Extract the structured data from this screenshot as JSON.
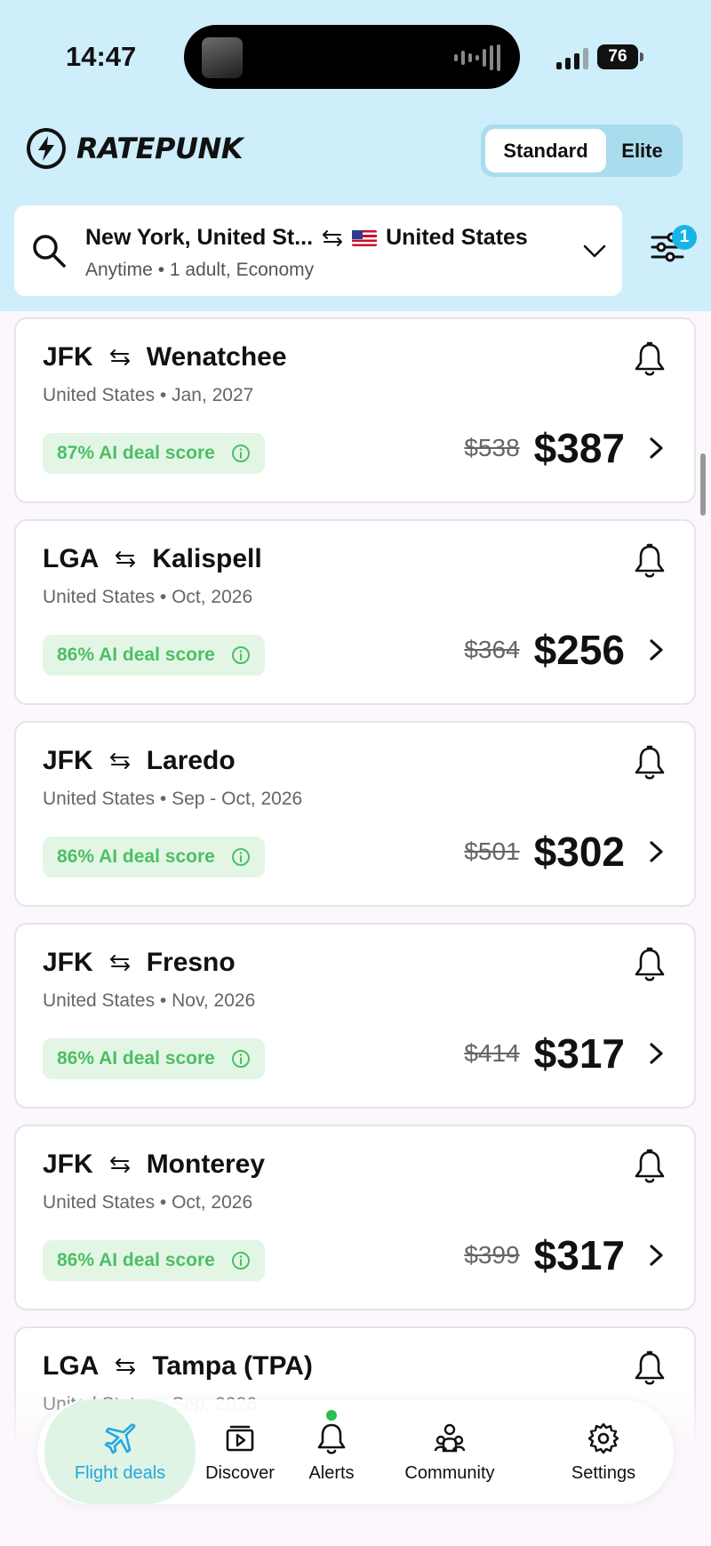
{
  "status_bar": {
    "time": "14:47",
    "battery": "76"
  },
  "brand": {
    "name": "RATEPUNK"
  },
  "plan_toggle": {
    "standard": "Standard",
    "elite": "Elite"
  },
  "search": {
    "origin": "New York, United St...",
    "destination": "United States",
    "details": "Anytime • 1 adult, Economy"
  },
  "filters": {
    "badge": "1"
  },
  "deals": [
    {
      "from": "JFK",
      "to": "Wenatchee",
      "meta": "United States • Jan, 2027",
      "score": "87% AI deal score",
      "old_price": "$538",
      "price": "$387"
    },
    {
      "from": "LGA",
      "to": "Kalispell",
      "meta": "United States • Oct, 2026",
      "score": "86% AI deal score",
      "old_price": "$364",
      "price": "$256"
    },
    {
      "from": "JFK",
      "to": "Laredo",
      "meta": "United States • Sep - Oct, 2026",
      "score": "86% AI deal score",
      "old_price": "$501",
      "price": "$302"
    },
    {
      "from": "JFK",
      "to": "Fresno",
      "meta": "United States • Nov, 2026",
      "score": "86% AI deal score",
      "old_price": "$414",
      "price": "$317"
    },
    {
      "from": "JFK",
      "to": "Monterey",
      "meta": "United States • Oct, 2026",
      "score": "86% AI deal score",
      "old_price": "$399",
      "price": "$317"
    },
    {
      "from": "LGA",
      "to": "Tampa (TPA)",
      "meta": "United States • Sep, 2026",
      "score": "",
      "old_price": "",
      "price": ""
    }
  ],
  "nav": {
    "flight_deals": "Flight deals",
    "discover": "Discover",
    "alerts": "Alerts",
    "community": "Community",
    "settings": "Settings"
  },
  "colors": {
    "header_bg": "#cdeefa",
    "accent": "#22a7df",
    "score_green": "#4cbf64"
  }
}
